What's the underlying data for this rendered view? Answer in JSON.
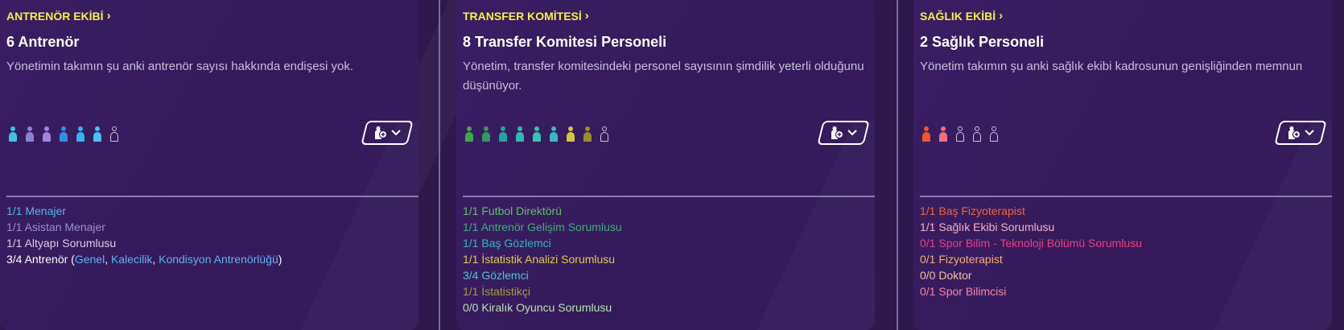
{
  "panels": [
    {
      "header": "ANTRENÖR EKİBİ",
      "count": "6 Antrenör",
      "description": "Yönetimin takımın şu anki antrenör sayısı hakkında endişesi yok.",
      "people_colors": [
        "#3ac4e6",
        "#8b7fd6",
        "#a084dc",
        "#2f8fe3",
        "#34b3f0",
        "#4bc0f2"
      ],
      "empty_slots": 1,
      "roles": [
        {
          "text": "1/1 Menajer",
          "color": "#4fb8ea"
        },
        {
          "text": "1/1 Asistan Menajer",
          "color": "#9a8fd4"
        },
        {
          "text": "1/1 Altyapı Sorumlusu",
          "color": "#d8d0e6"
        },
        {
          "text": "3/4 Antrenör (",
          "color": "#ffffff",
          "links": [
            "Genel",
            "Kalecilik",
            "Kondisyon Antrenörlüğü"
          ],
          "link_color": "#5fb2f5",
          "suffix": ")"
        }
      ]
    },
    {
      "header": "TRANSFER KOMİTESİ",
      "count": "8 Transfer Komitesi Personeli",
      "description": "Yönetim, transfer komitesindeki personel sayısının şimdilik yeterli olduğunu düşünüyor.",
      "people_colors": [
        "#3fa84a",
        "#2f9a60",
        "#22a59a",
        "#31b8b2",
        "#37c2b5",
        "#3ab8c8",
        "#d6c43a",
        "#9a8c2a"
      ],
      "empty_slots": 1,
      "roles": [
        {
          "text": "1/1 Futbol Direktörü",
          "color": "#5fc26a"
        },
        {
          "text": "1/1 Antrenör Gelişim Sorumlusu",
          "color": "#3fae79"
        },
        {
          "text": "1/1 Baş Gözlemci",
          "color": "#35b8c0"
        },
        {
          "text": "1/1 İstatistik Analizi Sorumlusu",
          "color": "#e0cc4d"
        },
        {
          "text": "3/4 Gözlemci",
          "color": "#4ec9c9"
        },
        {
          "text": "1/1 İstatistikçi",
          "color": "#a89a3a"
        },
        {
          "text": "0/0 Kiralık Oyuncu Sorumlusu",
          "color": "#b8e3b0"
        }
      ]
    },
    {
      "header": "SAĞLIK EKİBİ",
      "count": "2 Sağlık Personeli",
      "description": "Yönetim takımın şu anki sağlık ekibi kadrosunun genişliğinden memnun",
      "people_colors": [
        "#f0572e",
        "#f06f80"
      ],
      "empty_slots": 3,
      "roles": [
        {
          "text": "1/1 Baş Fizyoterapist",
          "color": "#f2643a"
        },
        {
          "text": "1/1 Sağlık Ekibi Sorumlusu",
          "color": "#f7b3c5"
        },
        {
          "text": "0/1 Spor Bilim - Teknoloji Bölümü Sorumlusu",
          "color": "#ef3f86"
        },
        {
          "text": "0/1 Fizyoterapist",
          "color": "#f5b07a"
        },
        {
          "text": "0/0 Doktor",
          "color": "#f5c4a0"
        },
        {
          "text": "0/1 Spor Bilimcisi",
          "color": "#f58aa8"
        }
      ]
    }
  ]
}
